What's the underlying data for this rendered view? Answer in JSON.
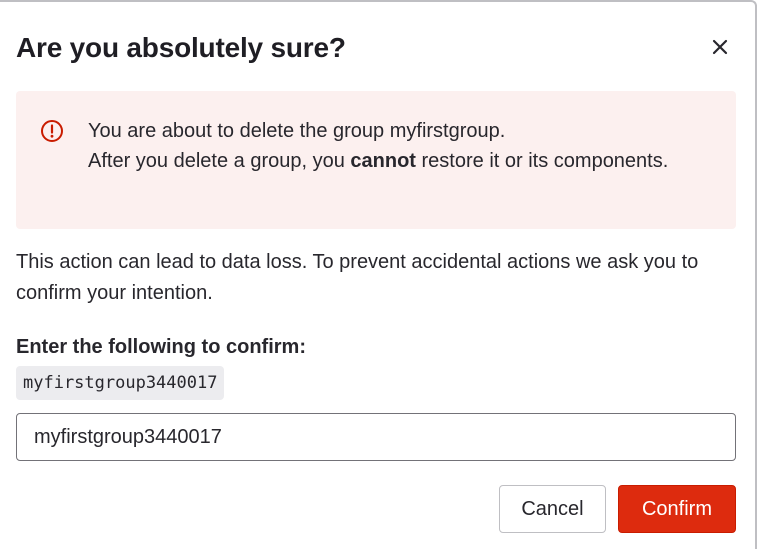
{
  "modal": {
    "title": "Are you absolutely sure?",
    "close_icon": "close-icon"
  },
  "alert": {
    "icon": "error-circle-icon",
    "line1": "You are about to delete the group myfirstgroup.",
    "line2_prefix": "After you delete a group, you ",
    "line2_bold": "cannot",
    "line2_suffix": " restore it or its components."
  },
  "description": "This action can lead to data loss. To prevent accidental actions we ask you to confirm your intention.",
  "confirm": {
    "label": "Enter the following to confirm:",
    "code": "myfirstgroup3440017",
    "input_value": "myfirstgroup3440017"
  },
  "buttons": {
    "cancel_label": "Cancel",
    "confirm_label": "Confirm"
  },
  "colors": {
    "alert_background": "#fcf0ef",
    "alert_icon": "#c91c00",
    "danger_button": "#dd2b0e"
  }
}
